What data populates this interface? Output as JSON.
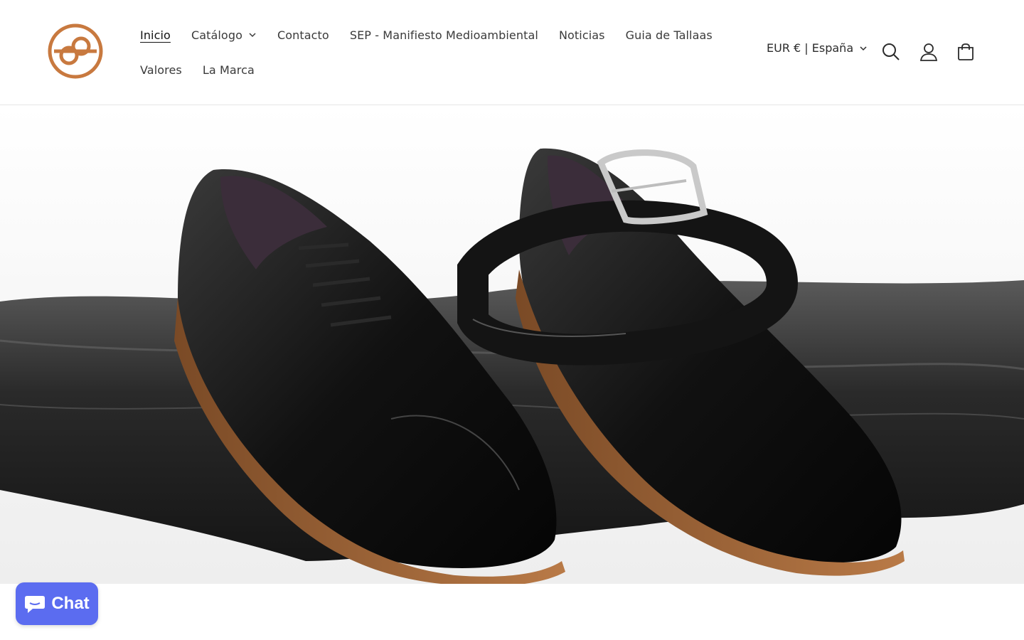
{
  "brand": {
    "logo_color": "#c8793f"
  },
  "nav": {
    "row1": [
      {
        "label": "Inicio",
        "active": true
      },
      {
        "label": "Catálogo",
        "dropdown": true
      },
      {
        "label": "Contacto"
      },
      {
        "label": "SEP - Manifiesto Medioambiental"
      },
      {
        "label": "Noticias"
      },
      {
        "label": "Guia de Tallaas"
      }
    ],
    "row2": [
      {
        "label": "Valores"
      },
      {
        "label": "La Marca"
      }
    ]
  },
  "header_tools": {
    "locale": "EUR € | España",
    "icons": [
      "search-icon",
      "account-icon",
      "cart-icon"
    ]
  },
  "hero": {
    "subject": "black oxford shoes with belt on leather"
  },
  "chat": {
    "label": "Chat",
    "color": "#5b6cf0"
  },
  "colors": {
    "accent": "#c8793f",
    "text": "#2b2b2b"
  }
}
